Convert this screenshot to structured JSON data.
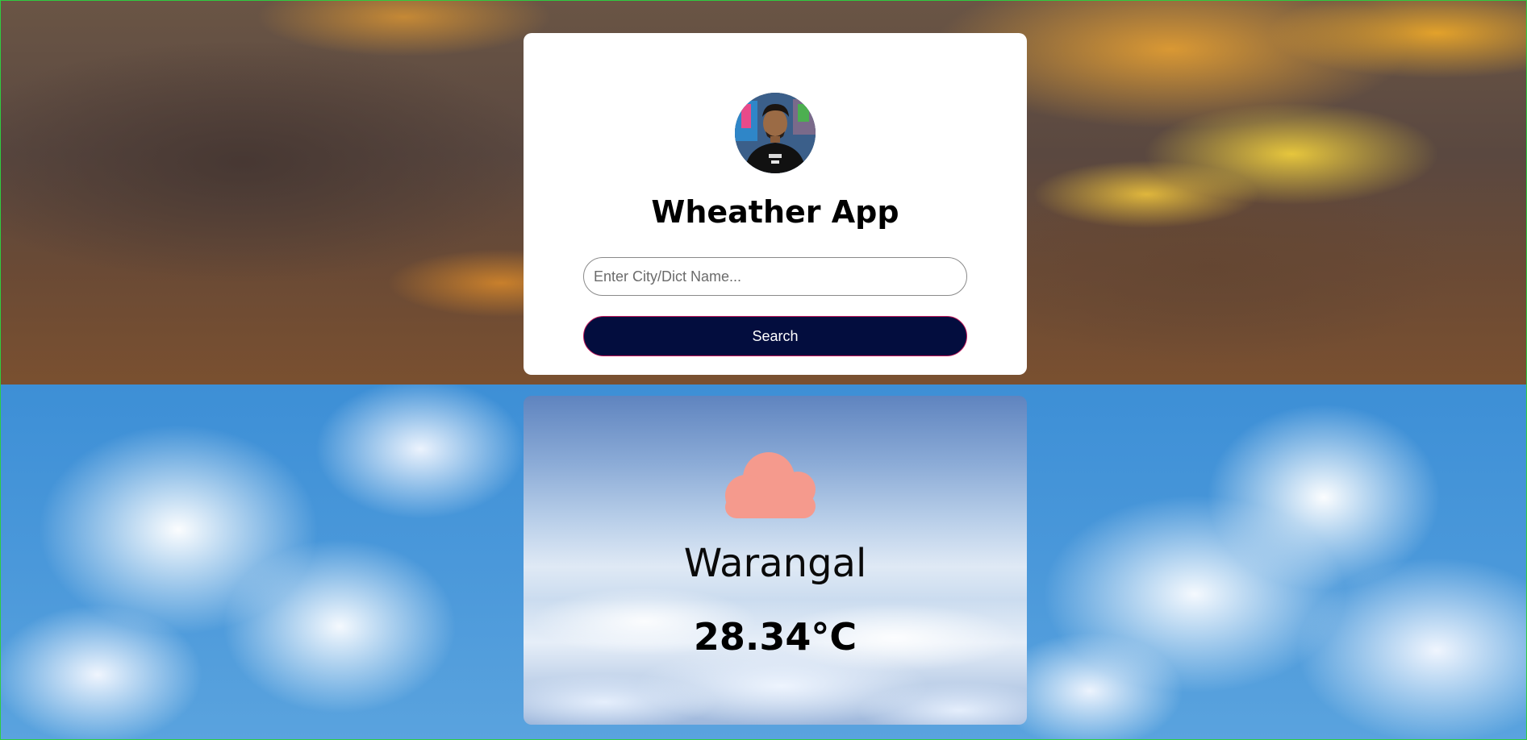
{
  "app": {
    "title": "Wheather App"
  },
  "search": {
    "placeholder": "Enter City/Dict Name...",
    "value": "",
    "button_label": "Search"
  },
  "weather": {
    "city": "Warangal",
    "temperature": "28.34°C",
    "icon": "cloud-icon",
    "icon_color": "#f59a8d"
  },
  "avatar": {
    "icon": "avatar-photo"
  },
  "colors": {
    "button_bg": "#030d3e",
    "button_border": "#c2185b",
    "card_bg": "#ffffff"
  }
}
